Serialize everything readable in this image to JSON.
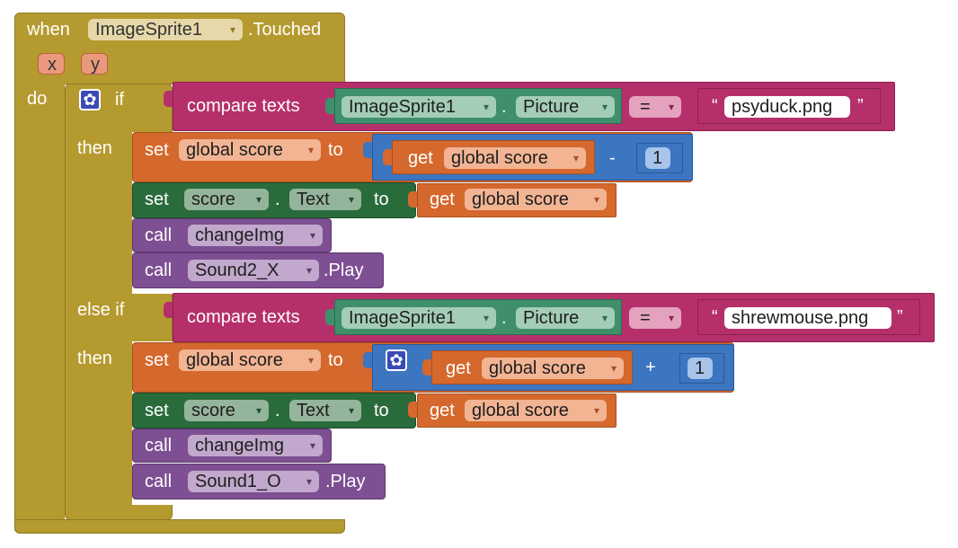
{
  "event": {
    "when": "when",
    "component": "ImageSprite1",
    "event_name": ".Touched",
    "params": [
      "x",
      "y"
    ],
    "do": "do"
  },
  "ifblock": {
    "if": "if",
    "then": "then",
    "elseif": "else if",
    "then2": "then"
  },
  "cond1": {
    "compare": "compare texts",
    "component": "ImageSprite1",
    "prop": "Picture",
    "dot": ".",
    "op": "=",
    "text": "psyduck.png",
    "open_quote": "“",
    "close_quote": "”"
  },
  "cond2": {
    "compare": "compare texts",
    "component": "ImageSprite1",
    "prop": "Picture",
    "dot": ".",
    "op": "=",
    "text": "shrewmouse.png",
    "open_quote": "“",
    "close_quote": "”"
  },
  "branch1": {
    "set": "set",
    "var": "global score",
    "to": "to",
    "get": "get",
    "getvar": "global score",
    "minus": "-",
    "num": "1",
    "set2": "set",
    "comp": "score",
    "dot": ".",
    "prop": "Text",
    "to2": "to",
    "get2": "get",
    "getvar2": "global score",
    "call1": "call",
    "proc": "changeImg",
    "call2": "call",
    "sound": "Sound2_X",
    "play": ".Play"
  },
  "branch2": {
    "set": "set",
    "var": "global score",
    "to": "to",
    "get": "get",
    "getvar": "global score",
    "plus": "+",
    "num": "1",
    "set2": "set",
    "comp": "score",
    "dot": ".",
    "prop": "Text",
    "to2": "to",
    "get2": "get",
    "getvar2": "global score",
    "call1": "call",
    "proc": "changeImg",
    "call2": "call",
    "sound": "Sound1_O",
    "play": ".Play"
  },
  "colors": {
    "event": "#b59a2f",
    "control": "#b59a2f",
    "text": "#b5306b",
    "component": "#3f8f6b",
    "variable": "#d5682d",
    "math": "#3c75c0",
    "setter": "#2a6b3c",
    "procedure": "#7e4f93",
    "white": "#ffffff"
  },
  "arrow_glyph": "▾",
  "gear_icon": "gear-icon"
}
